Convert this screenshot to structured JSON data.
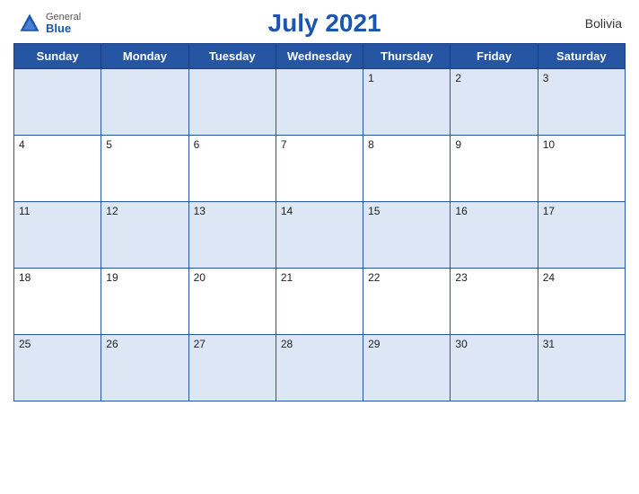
{
  "header": {
    "title": "July 2021",
    "country": "Bolivia",
    "logo": {
      "general": "General",
      "blue": "Blue"
    }
  },
  "weekdays": [
    "Sunday",
    "Monday",
    "Tuesday",
    "Wednesday",
    "Thursday",
    "Friday",
    "Saturday"
  ],
  "weeks": [
    [
      null,
      null,
      null,
      null,
      1,
      2,
      3
    ],
    [
      4,
      5,
      6,
      7,
      8,
      9,
      10
    ],
    [
      11,
      12,
      13,
      14,
      15,
      16,
      17
    ],
    [
      18,
      19,
      20,
      21,
      22,
      23,
      24
    ],
    [
      25,
      26,
      27,
      28,
      29,
      30,
      31
    ]
  ]
}
